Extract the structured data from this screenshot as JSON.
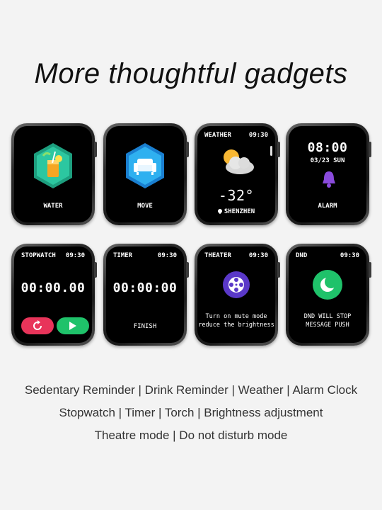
{
  "headline": "More thoughtful gadgets",
  "watches": {
    "water": {
      "label": "WATER"
    },
    "move": {
      "label": "MOVE"
    },
    "weather": {
      "title": "WEATHER",
      "time": "09:30",
      "temp": "-32°",
      "city": "SHENZHEN"
    },
    "alarm": {
      "time": "08:00",
      "date": "03/23 SUN",
      "label": "ALARM"
    },
    "stopwatch": {
      "title": "STOPWATCH",
      "time": "09:30",
      "value": "00:00.00"
    },
    "timer": {
      "title": "TIMER",
      "time": "09:30",
      "value": "00:00:00",
      "action": "FINISH"
    },
    "theater": {
      "title": "THEATER",
      "time": "09:30",
      "line1": "Turn on mute mode",
      "line2": "reduce the brightness"
    },
    "dnd": {
      "title": "DND",
      "time": "09:30",
      "line1": "DND WILL STOP",
      "line2": "MESSAGE PUSH"
    }
  },
  "captions": [
    "Sedentary Reminder | Drink Reminder | Weather | Alarm Clock",
    "Stopwatch | Timer | Torch | Brightness adjustment",
    "Theatre mode | Do not disturb mode"
  ],
  "colors": {
    "water_hex": "#27c39a",
    "move_hex": "#1aa0e6",
    "alarm_bell": "#8a4bdc",
    "reset_button": "#e8345a",
    "start_button": "#1fc26a",
    "theater_icon": "#5a38c8",
    "dnd_icon": "#1fc26a"
  }
}
